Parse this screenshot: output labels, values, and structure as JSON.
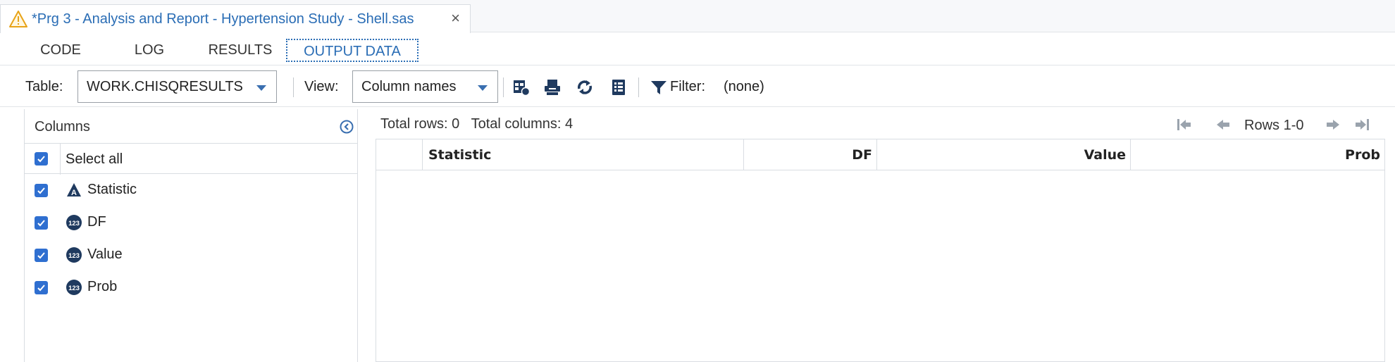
{
  "document_tab": {
    "title": "*Prg 3 - Analysis and Report - Hypertension Study - Shell.sas",
    "close_label": "×",
    "warning_icon": "warning-triangle-icon"
  },
  "subtabs": [
    {
      "label": "CODE",
      "active": false
    },
    {
      "label": "LOG",
      "active": false
    },
    {
      "label": "RESULTS",
      "active": false
    },
    {
      "label": "OUTPUT DATA",
      "active": true
    }
  ],
  "toolbar": {
    "table_label": "Table:",
    "table_value": "WORK.CHISQRESULTS",
    "view_label": "View:",
    "view_value": "Column names",
    "filter_label": "Filter:",
    "filter_value": "(none)"
  },
  "columns_panel": {
    "title": "Columns",
    "select_all_label": "Select all",
    "items": [
      {
        "label": "Statistic",
        "type": "character",
        "checked": true
      },
      {
        "label": "DF",
        "type": "numeric",
        "checked": true
      },
      {
        "label": "Value",
        "type": "numeric",
        "checked": true
      },
      {
        "label": "Prob",
        "type": "numeric",
        "checked": true
      }
    ]
  },
  "summary": {
    "total_rows": "Total rows: 0",
    "total_columns": "Total columns: 4"
  },
  "pager": {
    "rows_label": "Rows 1-0"
  },
  "grid": {
    "headers": [
      "Statistic",
      "DF",
      "Value",
      "Prob"
    ]
  },
  "colors": {
    "accent": "#2a6db5",
    "icon_dark": "#1f3a5f",
    "checkbox": "#2f6fd0",
    "warning": "#e8a317"
  }
}
